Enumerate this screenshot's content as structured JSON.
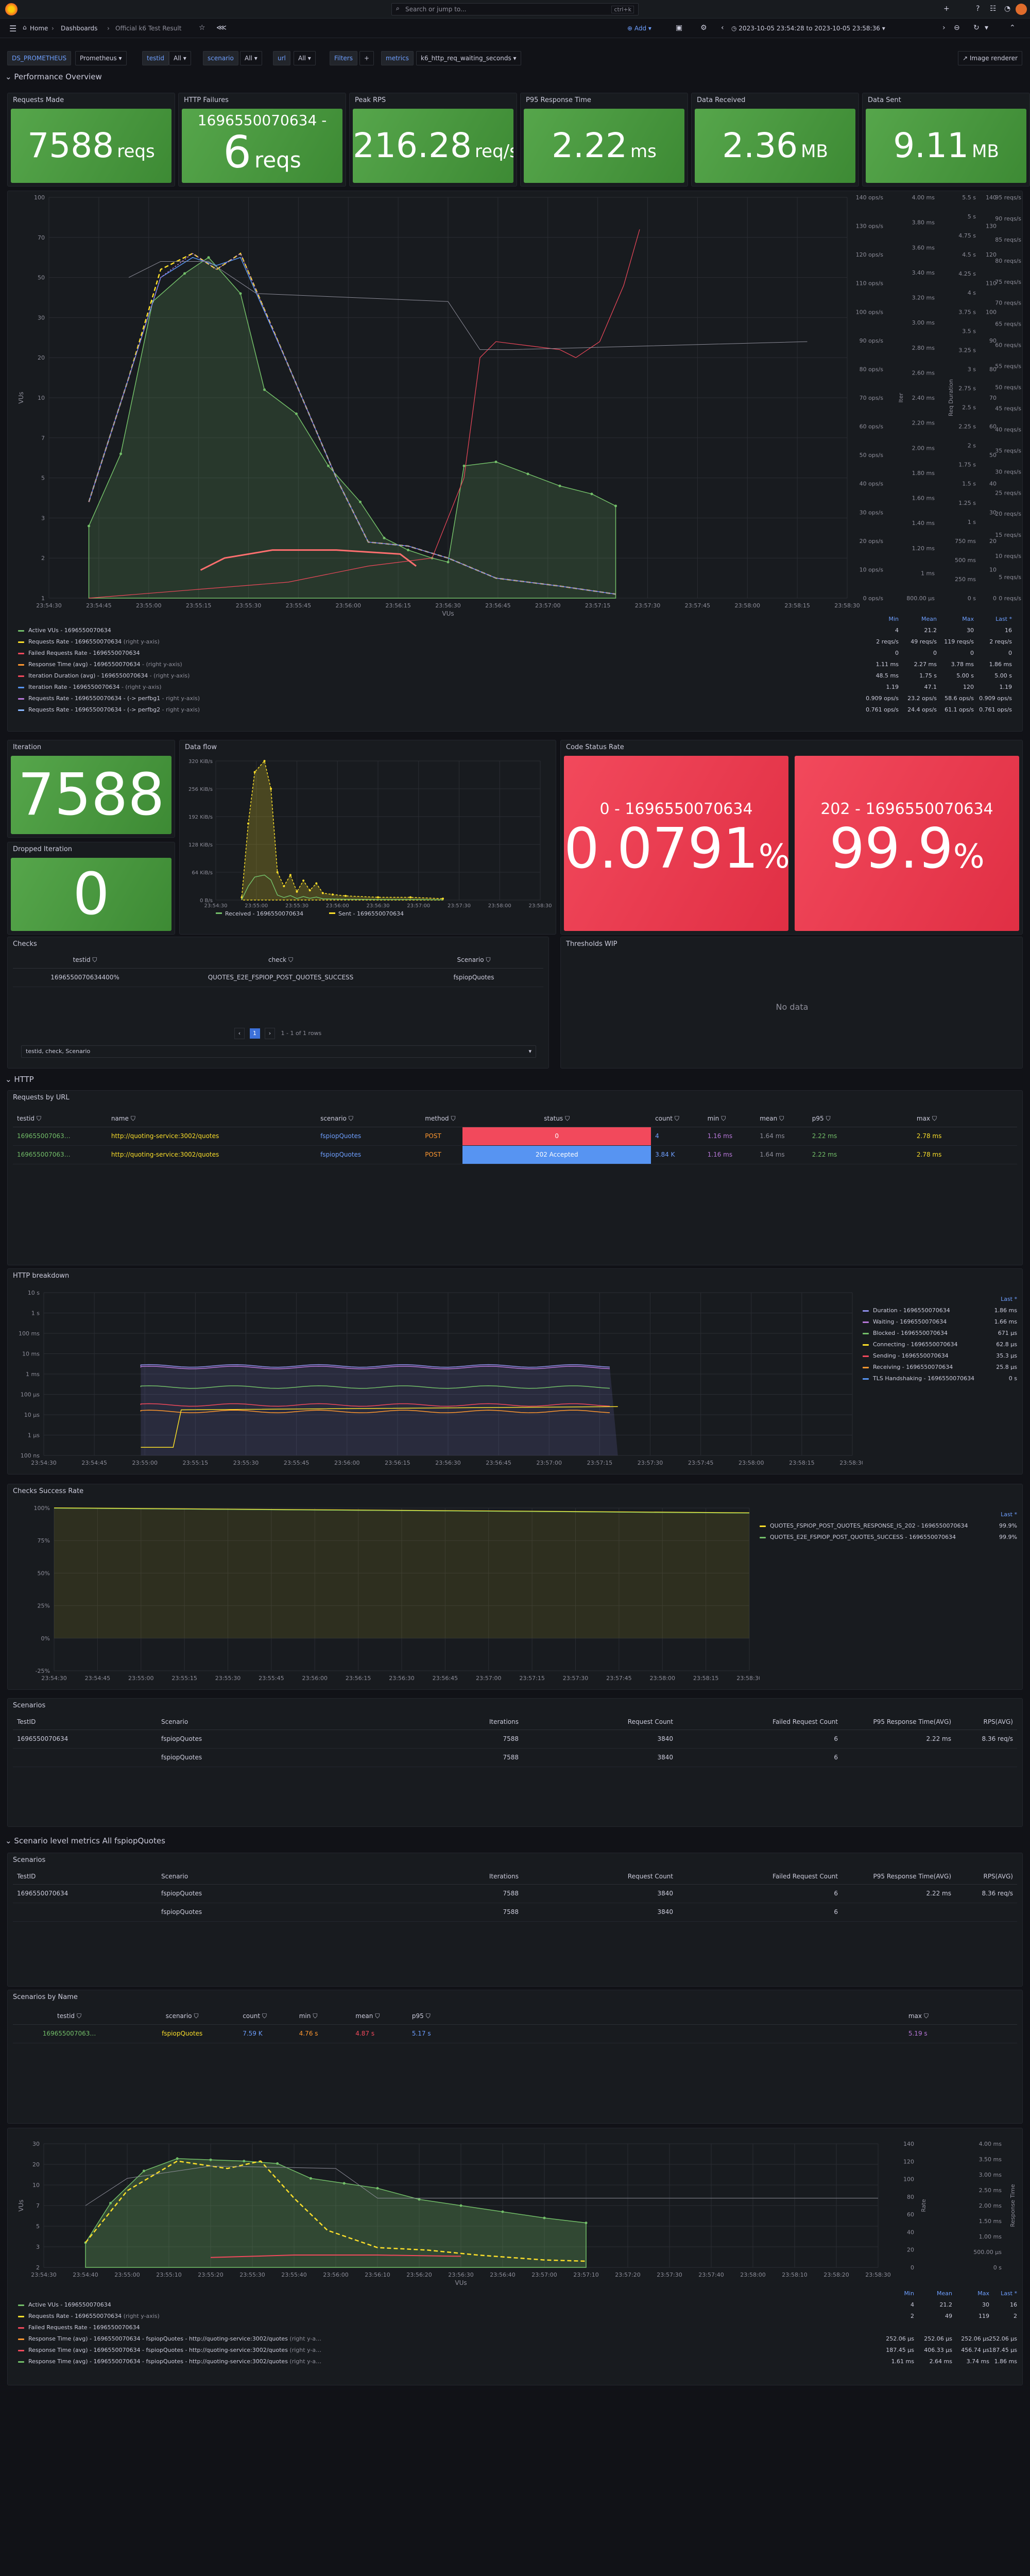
{
  "topbar": {
    "search_placeholder": "Search or jump to...",
    "shortcut": "ctrl+k"
  },
  "breadcrumb": {
    "home": "Home",
    "sep1": "›",
    "dashboards": "Dashboards",
    "sep2": "›",
    "current": "Official k6 Test Result"
  },
  "toolbar": {
    "add_label": "Add",
    "time_range": "2023-10-05 23:54:28 to 2023-10-05 23:58:36"
  },
  "vars": {
    "datasource_label": "DS_PROMETHEUS",
    "datasource_value": "Prometheus",
    "testid_label": "testid",
    "testid_value": "All",
    "scenario_label": "scenario",
    "scenario_value": "All",
    "url_label": "url",
    "url_value": "All",
    "filters_label": "Filters",
    "metrics_label": "metrics",
    "metrics_value": "k6_http_req_waiting_seconds",
    "image_renderer": "Image renderer"
  },
  "rows": {
    "performance": "Performance Overview",
    "http": "HTTP",
    "scenario_metrics": "Scenario level metrics All fspiopQuotes"
  },
  "stats": [
    {
      "title": "Requests Made",
      "value": "7588",
      "unit": "reqs",
      "prefix": ""
    },
    {
      "title": "HTTP Failures",
      "value": "6",
      "unit": "reqs",
      "prefix": "1696550070634 -"
    },
    {
      "title": "Peak RPS",
      "value": "216.28",
      "unit": "req/s",
      "prefix": ""
    },
    {
      "title": "P95 Response Time",
      "value": "2.22",
      "unit": "ms",
      "prefix": ""
    },
    {
      "title": "Data Received",
      "value": "2.36",
      "unit": "MB",
      "prefix": ""
    },
    {
      "title": "Data Sent",
      "value": "9.11",
      "unit": "MB",
      "prefix": ""
    }
  ],
  "main_chart": {
    "y_left_label": "VUs",
    "x_label": "VUs",
    "y_left_ticks": [
      "100",
      "70",
      "50",
      "30",
      "20",
      "10",
      "7",
      "5",
      "3",
      "2",
      "1"
    ],
    "x_ticks": [
      "23:54:30",
      "23:54:45",
      "23:55:00",
      "23:55:15",
      "23:55:30",
      "23:55:45",
      "23:56:00",
      "23:56:15",
      "23:56:30",
      "23:56:45",
      "23:57:00",
      "23:57:15",
      "23:57:30",
      "23:57:45",
      "23:58:00",
      "23:58:15",
      "23:58:30"
    ],
    "y_right1": [
      "140 ops/s",
      "130 ops/s",
      "120 ops/s",
      "110 ops/s",
      "100 ops/s",
      "90 ops/s",
      "80 ops/s",
      "70 ops/s",
      "60 ops/s",
      "50 ops/s",
      "40 ops/s",
      "30 ops/s",
      "20 ops/s",
      "10 ops/s",
      "0 ops/s"
    ],
    "y_right2": [
      "4.00 ms",
      "3.80 ms",
      "3.60 ms",
      "3.40 ms",
      "3.20 ms",
      "3.00 ms",
      "2.80 ms",
      "2.60 ms",
      "2.40 ms",
      "2.20 ms",
      "2.00 ms",
      "1.80 ms",
      "1.60 ms",
      "1.40 ms",
      "1.20 ms",
      "1 ms",
      "800.00 µs"
    ],
    "y_right2_label": "Iter",
    "y_right3": [
      "5.5 s",
      "5 s",
      "4.75 s",
      "4.5 s",
      "4.25 s",
      "4 s",
      "3.75 s",
      "3.5 s",
      "3.25 s",
      "3 s",
      "2.75 s",
      "2.5 s",
      "2.25 s",
      "2 s",
      "1.75 s",
      "1.5 s",
      "1.25 s",
      "1 s",
      "750 ms",
      "500 ms",
      "250 ms",
      "0 s"
    ],
    "y_right3_label": "Req Duration",
    "y_right4": [
      "140",
      "130",
      "120",
      "110",
      "100",
      "90",
      "80",
      "70",
      "60",
      "50",
      "40",
      "30",
      "20",
      "10",
      "0"
    ],
    "y_right5": [
      "95 reqs/s",
      "90 reqs/s",
      "85 reqs/s",
      "80 reqs/s",
      "75 reqs/s",
      "70 reqs/s",
      "65 reqs/s",
      "60 reqs/s",
      "55 reqs/s",
      "50 reqs/s",
      "45 reqs/s",
      "40 reqs/s",
      "35 reqs/s",
      "30 reqs/s",
      "25 reqs/s",
      "20 reqs/s",
      "15 reqs/s",
      "10 reqs/s",
      "5 reqs/s",
      "0 reqs/s"
    ]
  },
  "main_legend": {
    "headers": [
      "Min",
      "Mean",
      "Max",
      "Last *"
    ],
    "rows": [
      {
        "name": "Active VUs - 1696550070634",
        "suffix": "",
        "color": "#73bf69",
        "min": "4",
        "mean": "21.2",
        "max": "30",
        "last": "16"
      },
      {
        "name": "Requests Rate - 1696550070634",
        "suffix": " (right y-axis)",
        "color": "#fade2a",
        "min": "2 reqs/s",
        "mean": "49 reqs/s",
        "max": "119 reqs/s",
        "last": "2 reqs/s"
      },
      {
        "name": "Failed Requests Rate - 1696550070634",
        "suffix": "",
        "color": "#f2495c",
        "min": "0",
        "mean": "0",
        "max": "0",
        "last": "0"
      },
      {
        "name": "Response Time (avg) - 1696550070634",
        "suffix": " - (right y-axis)",
        "color": "#ff9830",
        "min": "1.11 ms",
        "mean": "2.27 ms",
        "max": "3.78 ms",
        "last": "1.86 ms"
      },
      {
        "name": "Iteration Duration (avg) - 1696550070634",
        "suffix": " - (right y-axis)",
        "color": "#f2495c",
        "min": "48.5 ms",
        "mean": "1.75 s",
        "max": "5.00 s",
        "last": "5.00 s"
      },
      {
        "name": "Iteration Rate - 1696550070634",
        "suffix": " - (right y-axis)",
        "color": "#5794f2",
        "min": "1.19",
        "mean": "47.1",
        "max": "120",
        "last": "1.19"
      },
      {
        "name": "Requests Rate - 1696550070634 - (-> perfbg1",
        "suffix": " - right y-axis)",
        "color": "#b877d9",
        "min": "0.909 ops/s",
        "mean": "23.2 ops/s",
        "max": "58.6 ops/s",
        "last": "0.909 ops/s"
      },
      {
        "name": "Requests Rate - 1696550070634 - (-> perfbg2",
        "suffix": " - right y-axis)",
        "color": "#8ab8ff",
        "min": "0.761 ops/s",
        "mean": "24.4 ops/s",
        "max": "61.1 ops/s",
        "last": "0.761 ops/s"
      }
    ]
  },
  "iteration_panel": {
    "title": "Iteration",
    "value": "7588"
  },
  "dropped_panel": {
    "title": "Dropped Iteration",
    "value": "0"
  },
  "dataflow": {
    "title": "Data flow",
    "y_ticks": [
      "320 KiB/s",
      "256 KiB/s",
      "192 KiB/s",
      "128 KiB/s",
      "64 KiB/s",
      "0 B/s"
    ],
    "x_ticks": [
      "23:54:30",
      "23:55:00",
      "23:55:30",
      "23:56:00",
      "23:56:30",
      "23:57:00",
      "23:57:30",
      "23:58:00",
      "23:58:30"
    ],
    "legend_received": "Received - 1696550070634",
    "legend_sent": "Sent - 1696550070634"
  },
  "code_status": {
    "title": "Code Status Rate",
    "items": [
      {
        "label": "0 - 1696550070634",
        "value": "0.0791",
        "unit": "%"
      },
      {
        "label": "202 - 1696550070634",
        "value": "99.9",
        "unit": "%"
      }
    ]
  },
  "checks": {
    "title": "Checks",
    "headers": [
      "testid",
      "check",
      "Scenario"
    ],
    "rows": [
      [
        "1696550070634400%",
        "QUOTES_E2E_FSPIOP_POST_QUOTES_SUCCESS",
        "fspiopQuotes"
      ]
    ],
    "page": "1",
    "page_info": "1 - 1 of 1 rows",
    "footer": "testid, check, Scenario"
  },
  "thresholds": {
    "title": "Thresholds WIP",
    "no_data": "No data"
  },
  "requests_by_url": {
    "title": "Requests by URL",
    "headers": [
      "testid",
      "name",
      "scenario",
      "method",
      "status",
      "count",
      "min",
      "mean",
      "p95",
      "max"
    ],
    "rows": [
      {
        "testid": "169655007063…",
        "name": "http://quoting-service:3002/quotes",
        "scenario": "fspiopQuotes",
        "method": "POST",
        "status": "0",
        "count": "4",
        "min": "1.16 ms",
        "mean": "1.64 ms",
        "p95": "2.22 ms",
        "max": "2.78 ms",
        "status_color": "#f2495c"
      },
      {
        "testid": "169655007063…",
        "name": "http://quoting-service:3002/quotes",
        "scenario": "fspiopQuotes",
        "method": "POST",
        "status": "202 Accepted",
        "count": "3.84 K",
        "min": "1.16 ms",
        "mean": "1.64 ms",
        "p95": "2.22 ms",
        "max": "2.78 ms",
        "status_color": "#5794f2"
      }
    ]
  },
  "http_breakdown": {
    "title": "HTTP breakdown",
    "y_ticks": [
      "10 s",
      "1 s",
      "100 ms",
      "10 ms",
      "1 ms",
      "100 µs",
      "10 µs",
      "1 µs",
      "100 ns"
    ],
    "x_ticks": [
      "23:54:30",
      "23:54:45",
      "23:55:00",
      "23:55:15",
      "23:55:30",
      "23:55:45",
      "23:56:00",
      "23:56:15",
      "23:56:30",
      "23:56:45",
      "23:57:00",
      "23:57:15",
      "23:57:30",
      "23:57:45",
      "23:58:00",
      "23:58:15",
      "23:58:30"
    ],
    "legend_header": "Last *",
    "legend": [
      {
        "name": "Duration - 1696550070634",
        "value": "1.86 ms",
        "color": "#8e8ee8"
      },
      {
        "name": "Waiting - 1696550070634",
        "value": "1.66 ms",
        "color": "#b877d9"
      },
      {
        "name": "Blocked - 1696550070634",
        "value": "671 µs",
        "color": "#73bf69"
      },
      {
        "name": "Connecting - 1696550070634",
        "value": "62.8 µs",
        "color": "#fade2a"
      },
      {
        "name": "Sending - 1696550070634",
        "value": "35.3 µs",
        "color": "#f2495c"
      },
      {
        "name": "Receiving - 1696550070634",
        "value": "25.8 µs",
        "color": "#ff9830"
      },
      {
        "name": "TLS Handshaking - 1696550070634",
        "value": "0 s",
        "color": "#5794f2"
      }
    ]
  },
  "checks_success": {
    "title": "Checks Success Rate",
    "y_ticks": [
      "100%",
      "75%",
      "50%",
      "25%",
      "0%",
      "-25%"
    ],
    "x_ticks": [
      "23:54:30",
      "23:54:45",
      "23:55:00",
      "23:55:15",
      "23:55:30",
      "23:55:45",
      "23:56:00",
      "23:56:15",
      "23:56:30",
      "23:56:45",
      "23:57:00",
      "23:57:15",
      "23:57:30",
      "23:57:45",
      "23:58:00",
      "23:58:15",
      "23:58:30"
    ],
    "legend_header": "Last *",
    "legend": [
      {
        "name": "QUOTES_FSPIOP_POST_QUOTES_RESPONSE_IS_202 - 1696550070634",
        "value": "99.9%",
        "color": "#fade2a"
      },
      {
        "name": "QUOTES_E2E_FSPIOP_POST_QUOTES_SUCCESS - 1696550070634",
        "value": "99.9%",
        "color": "#73bf69"
      }
    ]
  },
  "scenarios1": {
    "title": "Scenarios",
    "headers": [
      "TestID",
      "Scenario",
      "Iterations",
      "Request Count",
      "Failed Request Count",
      "P95 Response Time(AVG)",
      "RPS(AVG)"
    ],
    "rows": [
      [
        "1696550070634",
        "fspiopQuotes",
        "7588",
        "3840",
        "6",
        "2.22 ms",
        "8.36 req/s"
      ],
      [
        "",
        "fspiopQuotes",
        "7588",
        "3840",
        "6",
        "",
        ""
      ]
    ]
  },
  "scenarios2": {
    "title": "Scenarios",
    "headers": [
      "TestID",
      "Scenario",
      "Iterations",
      "Request Count",
      "Failed Request Count",
      "P95 Response Time(AVG)",
      "RPS(AVG)"
    ],
    "rows": [
      [
        "1696550070634",
        "fspiopQuotes",
        "7588",
        "3840",
        "6",
        "2.22 ms",
        "8.36 req/s"
      ],
      [
        "",
        "fspiopQuotes",
        "7588",
        "3840",
        "6",
        "",
        ""
      ]
    ]
  },
  "scenarios_by_name": {
    "title": "Scenarios by Name",
    "headers": [
      "testid",
      "scenario",
      "count",
      "min",
      "mean",
      "p95",
      "max"
    ],
    "rows": [
      [
        "169655007063…",
        "fspiopQuotes",
        "7.59 K",
        "4.76 s",
        "4.87 s",
        "5.17 s",
        "5.19 s"
      ]
    ]
  },
  "bottom_chart": {
    "y_left_label": "VUs",
    "x_label": "VUs",
    "y_left_ticks": [
      "30",
      "20",
      "10",
      "7",
      "5",
      "3",
      "2"
    ],
    "x_ticks": [
      "23:54:30",
      "23:54:40",
      "23:55:00",
      "23:55:10",
      "23:55:20",
      "23:55:30",
      "23:55:40",
      "23:56:00",
      "23:56:10",
      "23:56:20",
      "23:56:30",
      "23:56:40",
      "23:57:00",
      "23:57:10",
      "23:57:20",
      "23:57:30",
      "23:57:40",
      "23:58:00",
      "23:58:10",
      "23:58:20",
      "23:58:30"
    ],
    "y_mid": [
      "140",
      "120",
      "100",
      "80",
      "60",
      "40",
      "20",
      "0"
    ],
    "y_mid_label": "Rate",
    "y_right": [
      "4.00 ms",
      "3.50 ms",
      "3.00 ms",
      "2.50 ms",
      "2.00 ms",
      "1.50 ms",
      "1.00 ms",
      "500.00 µs",
      "0 s"
    ],
    "y_right_label": "Response Time"
  },
  "bottom_legend": {
    "headers": [
      "Min",
      "Mean",
      "Max",
      "Last *"
    ],
    "rows": [
      {
        "name": "Active VUs - 1696550070634",
        "suffix": "",
        "color": "#73bf69",
        "min": "4",
        "mean": "21.2",
        "max": "30",
        "last": "16"
      },
      {
        "name": "Requests Rate - 1696550070634",
        "suffix": " (right y-axis)",
        "color": "#fade2a",
        "min": "2",
        "mean": "49",
        "max": "119",
        "last": "2"
      },
      {
        "name": "Failed Requests Rate - 1696550070634",
        "suffix": "",
        "color": "#f2495c",
        "min": "",
        "mean": "",
        "max": "",
        "last": ""
      },
      {
        "name": "Response Time (avg) - 1696550070634 - fspiopQuotes - http://quoting-service:3002/quotes",
        "suffix": " (right y-a…",
        "color": "#ff9830",
        "min": "252.06 µs",
        "mean": "252.06 µs",
        "max": "252.06 µs",
        "last": "252.06 µs"
      },
      {
        "name": "Response Time (avg) - 1696550070634 - fspiopQuotes - http://quoting-service:3002/quotes",
        "suffix": " (right y-a…",
        "color": "#f2495c",
        "min": "187.45 µs",
        "mean": "406.33 µs",
        "max": "456.74 µs",
        "last": "187.45 µs"
      },
      {
        "name": "Response Time (avg) - 1696550070634 - fspiopQuotes - http://quoting-service:3002/quotes",
        "suffix": " (right y-a…",
        "color": "#73bf69",
        "min": "1.61 ms",
        "mean": "2.64 ms",
        "max": "3.74 ms",
        "last": "1.86 ms"
      }
    ]
  }
}
